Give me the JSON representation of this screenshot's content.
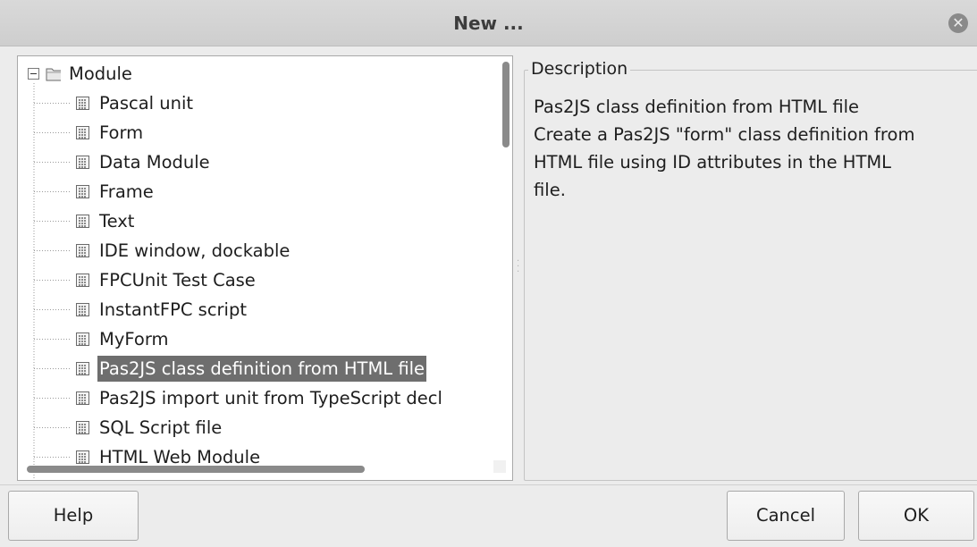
{
  "window": {
    "title": "New ...",
    "close_icon": "close-icon"
  },
  "tree": {
    "root": {
      "label": "Module",
      "icon": "folder-icon",
      "expanded": true
    },
    "items": [
      {
        "label": "Pascal unit",
        "icon": "file-icon",
        "selected": false
      },
      {
        "label": "Form",
        "icon": "file-icon",
        "selected": false
      },
      {
        "label": "Data Module",
        "icon": "file-icon",
        "selected": false
      },
      {
        "label": "Frame",
        "icon": "file-icon",
        "selected": false
      },
      {
        "label": "Text",
        "icon": "file-icon",
        "selected": false
      },
      {
        "label": "IDE window, dockable",
        "icon": "file-icon",
        "selected": false
      },
      {
        "label": "FPCUnit Test Case",
        "icon": "file-icon",
        "selected": false
      },
      {
        "label": "InstantFPC script",
        "icon": "file-icon",
        "selected": false
      },
      {
        "label": "MyForm",
        "icon": "file-icon",
        "selected": false
      },
      {
        "label": "Pas2JS class definition from HTML file",
        "icon": "file-icon",
        "selected": true
      },
      {
        "label": "Pas2JS import unit from TypeScript decl",
        "icon": "file-icon",
        "selected": false
      },
      {
        "label": "SQL Script file",
        "icon": "file-icon",
        "selected": false
      },
      {
        "label": "HTML Web Module",
        "icon": "file-icon",
        "selected": false
      }
    ]
  },
  "description": {
    "legend": "Description",
    "lines": [
      "Pas2JS class definition from HTML file",
      "Create a Pas2JS \"form\" class definition from",
      "HTML file using ID attributes in the HTML",
      "file."
    ]
  },
  "buttons": {
    "help": "Help",
    "cancel": "Cancel",
    "ok": "OK"
  },
  "colors": {
    "selection": "#6e6e6e",
    "selection_text": "#ffffff",
    "titlebar": "#d4d4d4",
    "dialog_bg": "#ececec"
  }
}
